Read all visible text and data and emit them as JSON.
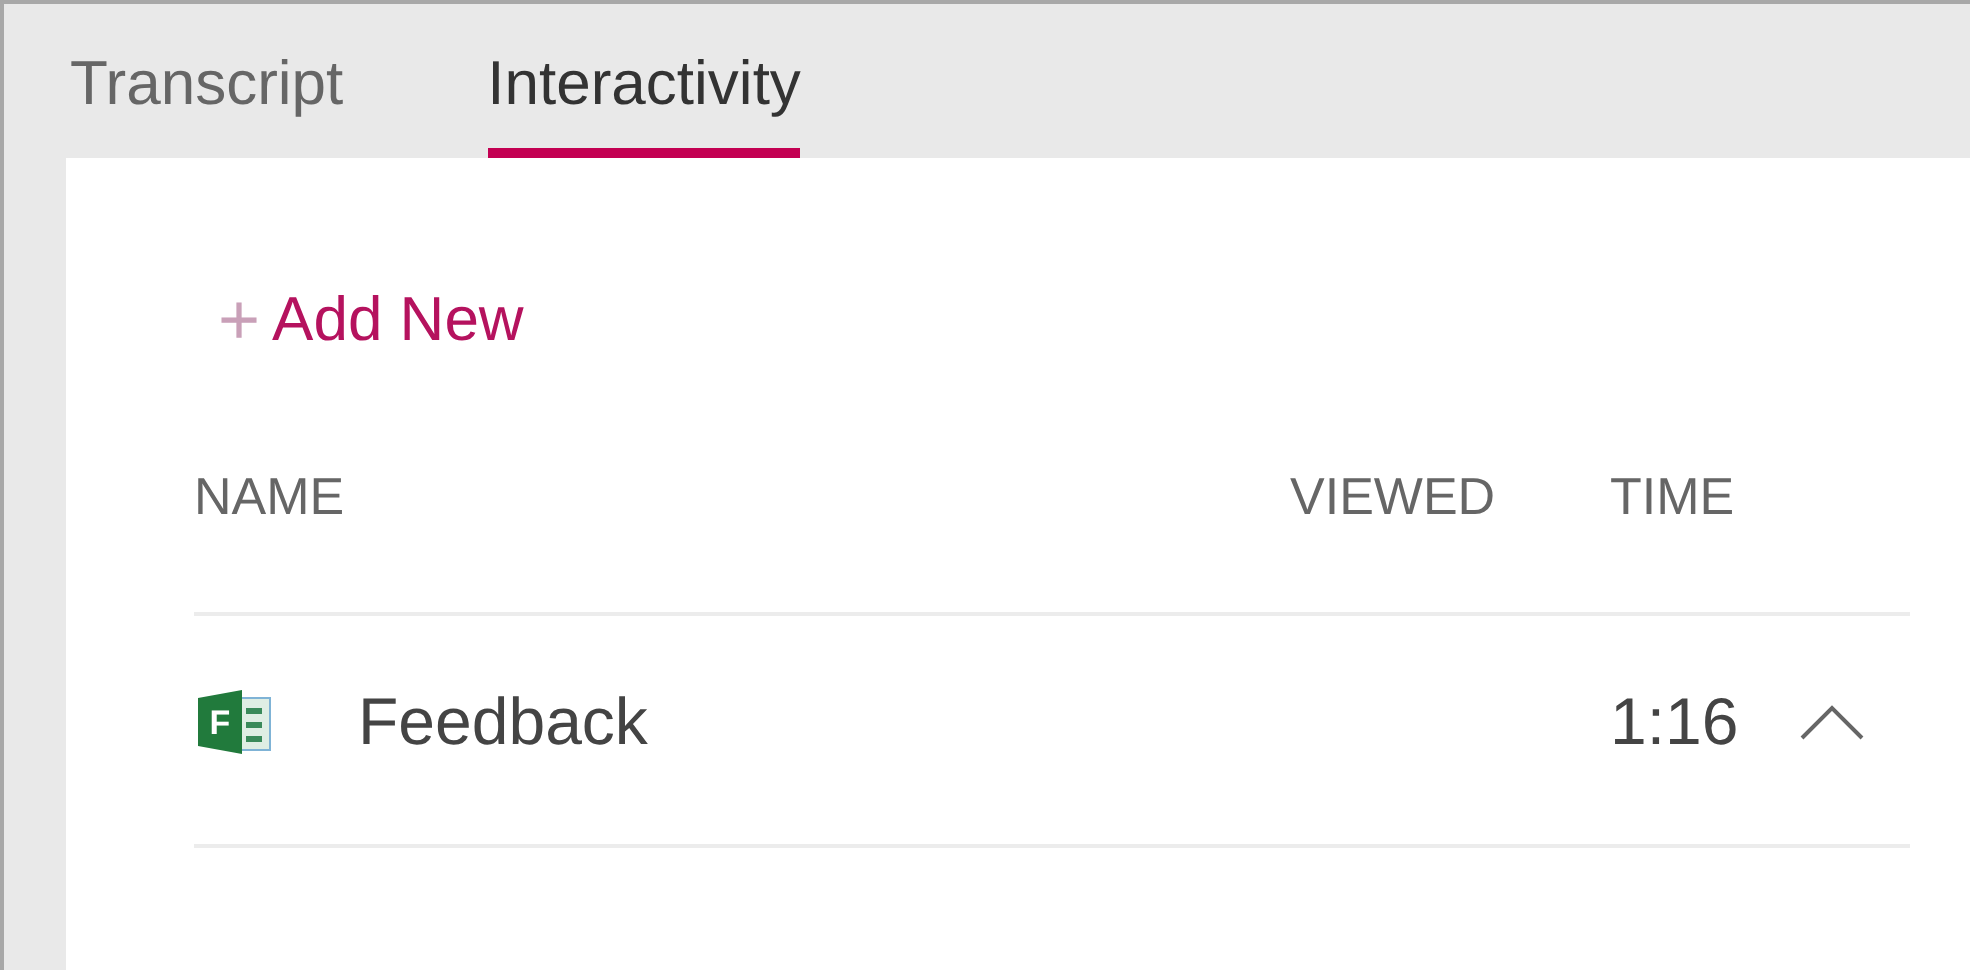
{
  "tabs": [
    {
      "label": "Transcript",
      "selected": false
    },
    {
      "label": "Interactivity",
      "selected": true
    }
  ],
  "add_button": {
    "icon": "+",
    "label": "Add New"
  },
  "table": {
    "columns": [
      "NAME",
      "VIEWED",
      "TIME"
    ],
    "rows": [
      {
        "icon_letter": "F",
        "name": "Feedback",
        "time": "1:16",
        "expanded": true
      }
    ]
  }
}
